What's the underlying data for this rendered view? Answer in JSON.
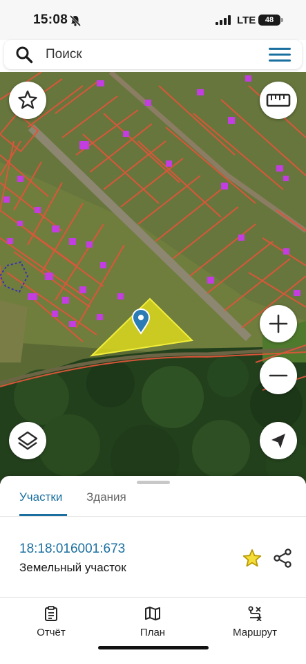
{
  "status_bar": {
    "time": "15:08",
    "network": "LTE",
    "battery": "48"
  },
  "search": {
    "placeholder": "Поиск"
  },
  "map": {
    "parcel_highlight_color": "#e6e01c",
    "parcel_border_color": "#e0553a",
    "building_color": "#c23ee0",
    "pin_color": "#2b7bb5"
  },
  "sheet": {
    "tabs": [
      {
        "label": "Участки",
        "active": true
      },
      {
        "label": "Здания",
        "active": false
      }
    ],
    "parcel": {
      "cadastral_number": "18:18:016001:673",
      "type": "Земельный участок"
    }
  },
  "bottom_nav": {
    "items": [
      {
        "label": "Отчёт",
        "icon": "report-icon"
      },
      {
        "label": "План",
        "icon": "map-plan-icon"
      },
      {
        "label": "Маршрут",
        "icon": "route-icon"
      }
    ]
  },
  "colors": {
    "accent": "#1a6fa0",
    "favorite": "#d9b800"
  }
}
